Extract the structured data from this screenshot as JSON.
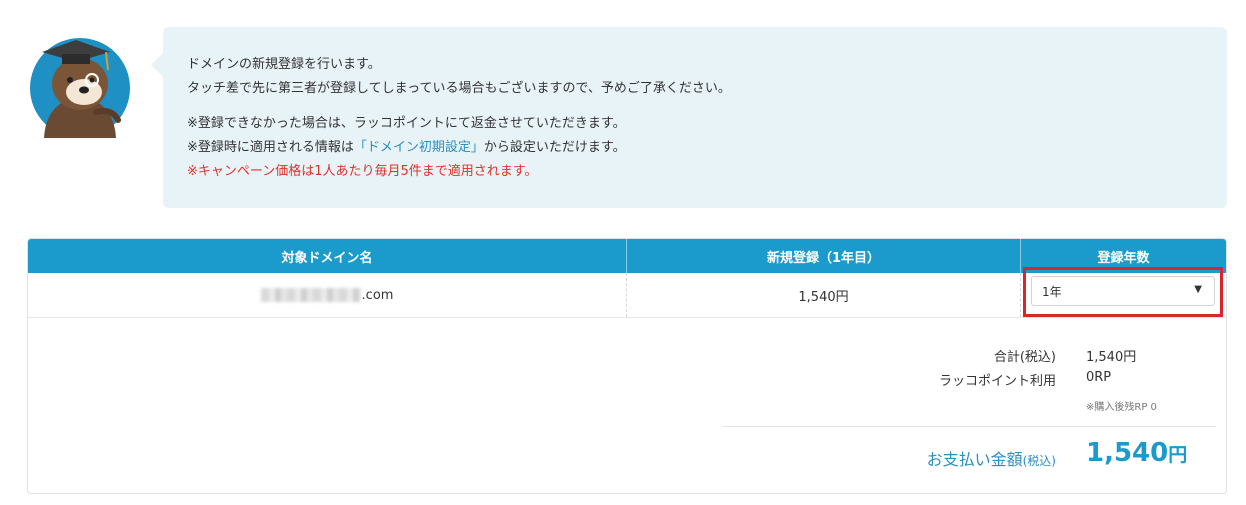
{
  "notice": {
    "line1": "ドメインの新規登録を行います。",
    "line2": "タッチ差で先に第三者が登録してしまっている場合もございますので、予めご了承ください。",
    "line3": "※登録できなかった場合は、ラッコポイントにて返金させていただきます。",
    "line4_pre": "※登録時に適用される情報は",
    "line4_link": "「ドメイン初期設定」",
    "line4_post": "から設定いただけます。",
    "line5": "※キャンペーン価格は1人あたり毎月5件まで適用されます。"
  },
  "table": {
    "headers": [
      "対象ドメイン名",
      "新規登録（1年目）",
      "登録年数"
    ],
    "row": {
      "domain_suffix": ".com",
      "price": "1,540円",
      "years_selected": "1年"
    }
  },
  "summary": {
    "total_label": "合計(税込)",
    "total_value": "1,540円",
    "points_label": "ラッコポイント利用",
    "points_value": "0RP",
    "points_note": "※購入後残RP 0",
    "pay_label": "お支払い金額",
    "pay_label_suffix": "(税込)",
    "pay_amount": "1,540",
    "pay_unit": "円"
  },
  "colors": {
    "header_blue": "#1a9bcb",
    "notice_bg": "#e8f3f8",
    "highlight_red": "#d9262b",
    "warning_red": "#e0312b",
    "link_blue": "#2a8fc1"
  }
}
